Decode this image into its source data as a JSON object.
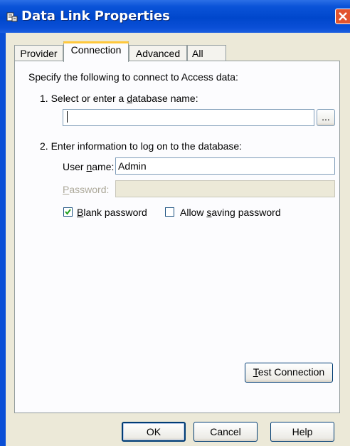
{
  "window": {
    "title": "Data Link Properties"
  },
  "tabs": [
    {
      "label": "Provider"
    },
    {
      "label": "Connection"
    },
    {
      "label": "Advanced"
    },
    {
      "label": "All"
    }
  ],
  "active_tab": "Connection",
  "connection": {
    "intro": "Specify the following to connect to Access data:",
    "step1_label_pre": "1. Select or enter a ",
    "step1_label_key": "d",
    "step1_label_post": "atabase name:",
    "database_name_value": "",
    "browse_label": "...",
    "step2_label": "2. Enter information to log on to the database:",
    "username_label_pre": "User ",
    "username_label_key": "n",
    "username_label_post": "ame:",
    "username_value": "Admin",
    "password_label_key": "P",
    "password_label_post": "assword:",
    "password_value": "",
    "blank_password_key": "B",
    "blank_password_post": "lank password",
    "blank_password_checked": true,
    "allow_saving_pre": "Allow ",
    "allow_saving_key": "s",
    "allow_saving_post": "aving password",
    "allow_saving_checked": false,
    "test_connection_key": "T",
    "test_connection_post": "est Connection"
  },
  "footer": {
    "ok_label": "OK",
    "cancel_label": "Cancel",
    "help_label": "Help"
  },
  "colors": {
    "titlebar": "#0047cc",
    "dialog_bg": "#ece9d8",
    "close_button": "#e2542e",
    "active_tab_highlight": "#ffc83c"
  }
}
